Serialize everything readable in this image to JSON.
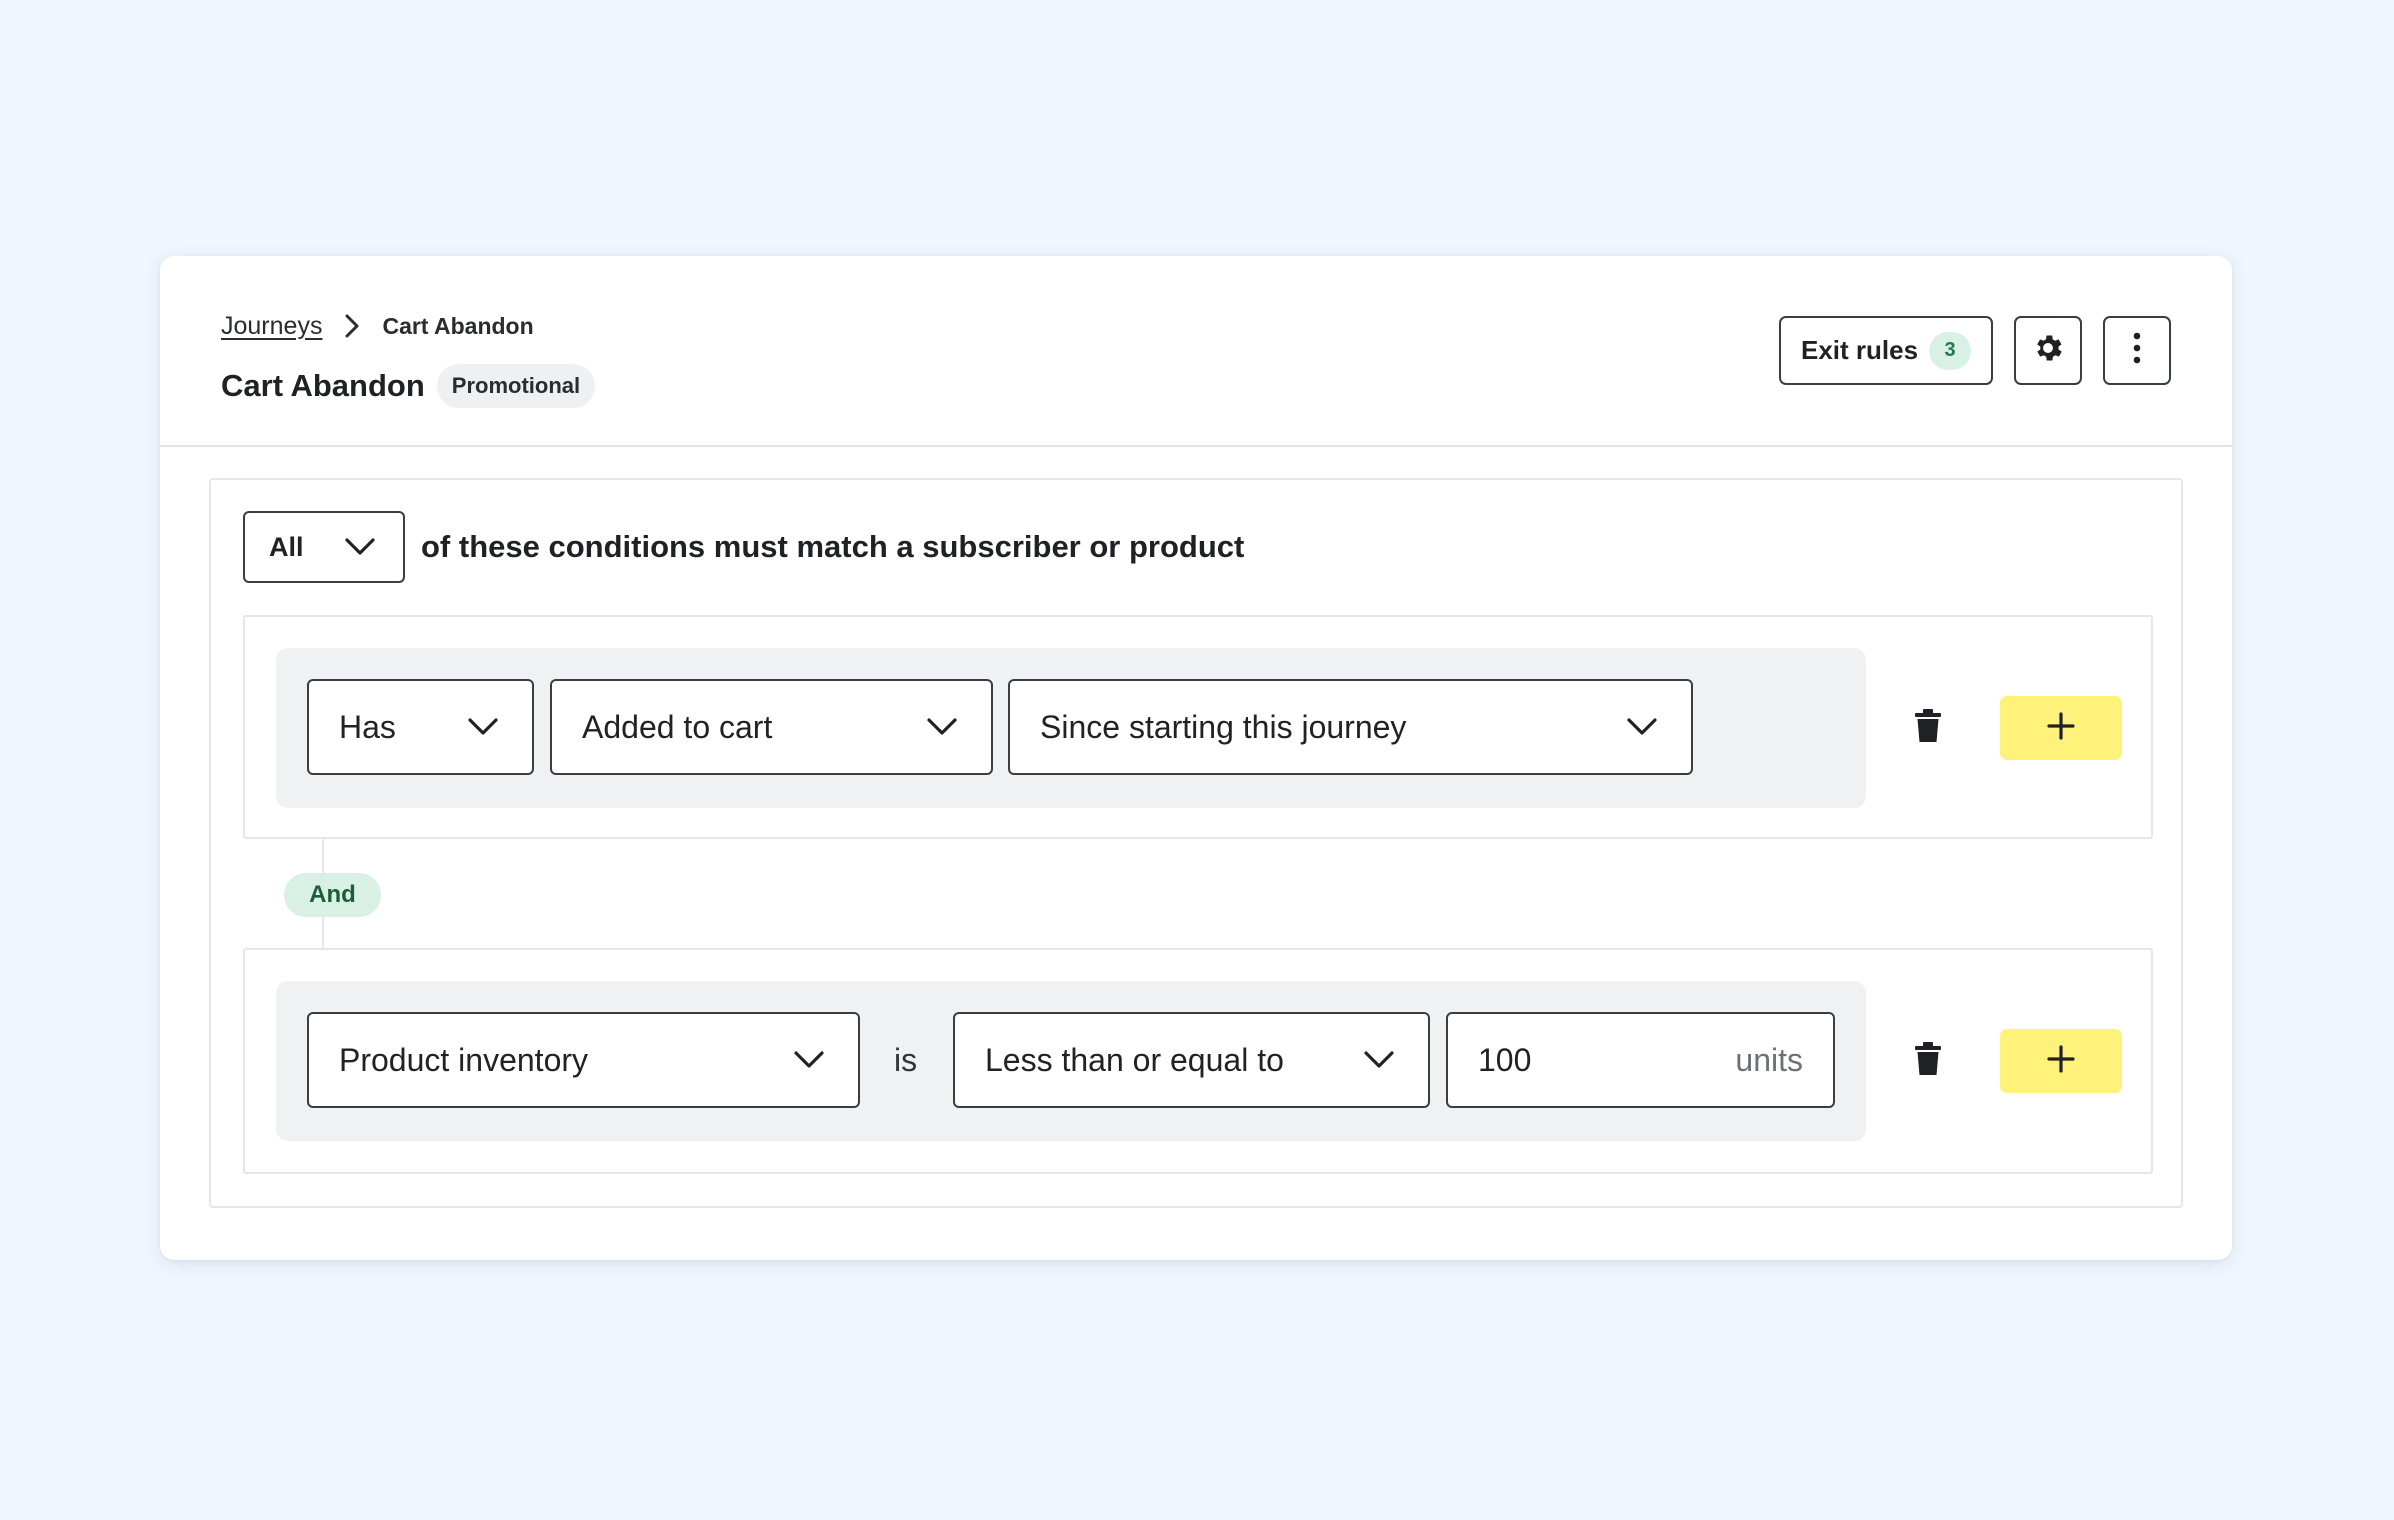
{
  "breadcrumb": {
    "parent": "Journeys",
    "current": "Cart Abandon"
  },
  "page": {
    "title": "Cart Abandon",
    "badge": "Promotional"
  },
  "actions": {
    "exit_rules_label": "Exit rules",
    "exit_rules_count": "3",
    "settings_icon": "gear-icon",
    "more_icon": "more-vertical-icon"
  },
  "rules": {
    "match_selector": "All",
    "match_text": "of these conditions must match a subscriber or product",
    "connector_label": "And",
    "conditions": [
      {
        "qualifier": "Has",
        "event": "Added to cart",
        "timeframe": "Since starting this journey"
      },
      {
        "property": "Product inventory",
        "verb": "is",
        "operator": "Less than or equal to",
        "value": "100",
        "unit": "units"
      }
    ]
  },
  "colors": {
    "background": "#eff6fd",
    "add_button": "#fff27a",
    "and_badge": "#d9f0e4",
    "count_badge_text": "#1f7b4a"
  }
}
